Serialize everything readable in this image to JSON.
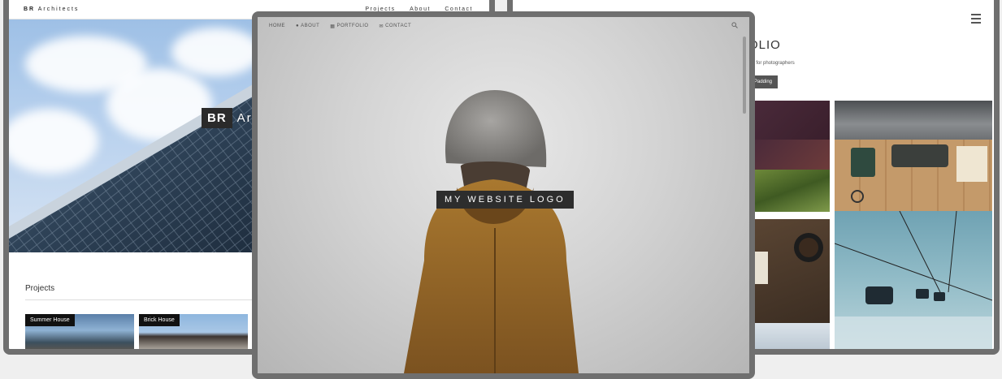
{
  "left_site": {
    "brand_bold": "BR",
    "brand_rest": "Architects",
    "nav": [
      "Projects",
      "About",
      "Contact"
    ],
    "hero_box": "BR",
    "hero_rest": "Arc",
    "projects_heading": "Projects",
    "project_cards": [
      {
        "label": "Summer House"
      },
      {
        "label": "Brick House"
      }
    ]
  },
  "right_site": {
    "title": "OLIO",
    "subtitle": "cts for photographers",
    "button": "Padding",
    "menu_icon": "hamburger-icon"
  },
  "center_site": {
    "nav": [
      {
        "label": "HOME",
        "icon": ""
      },
      {
        "label": "ABOUT",
        "icon": "user-icon"
      },
      {
        "label": "PORTFOLIO",
        "icon": "grid-icon"
      },
      {
        "label": "CONTACT",
        "icon": "envelope-icon"
      }
    ],
    "search_icon": "search-icon",
    "logo_text": "MY WEBSITE LOGO"
  },
  "colors": {
    "frame_border": "#6f6f6f",
    "page_background": "#efefef",
    "logo_box": "#2d2d2d"
  }
}
